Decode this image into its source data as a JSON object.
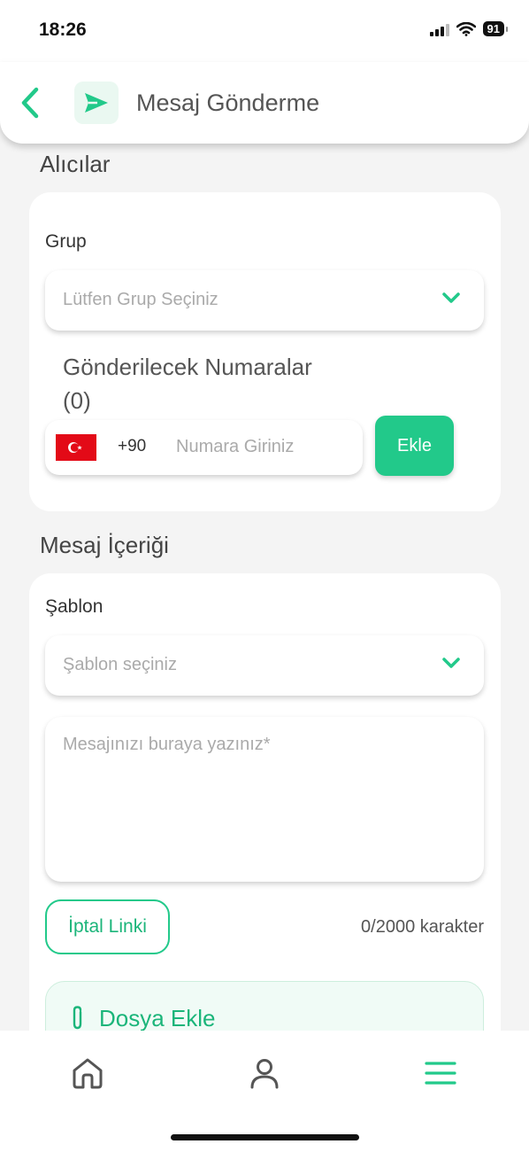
{
  "status_bar": {
    "time": "18:26",
    "battery": "91"
  },
  "header": {
    "title": "Mesaj Gönderme"
  },
  "recipients": {
    "section_title": "Alıcılar",
    "group_label": "Grup",
    "group_placeholder": "Lütfen Grup Seçiniz",
    "numbers_label": "Gönderilecek Numaralar",
    "numbers_count": "(0)",
    "dial_code": "+90",
    "phone_placeholder": "Numara Giriniz",
    "add_button": "Ekle"
  },
  "message": {
    "section_title": "Mesaj İçeriği",
    "template_label": "Şablon",
    "template_placeholder": "Şablon seçiniz",
    "message_placeholder": "Mesajınızı buraya yazınız*",
    "cancel_link_button": "İptal Linki",
    "char_counter": "0/2000 karakter",
    "attach_file": "Dosya Ekle"
  },
  "bottom_nav": {
    "items": [
      "home-icon",
      "profile-icon",
      "menu-icon"
    ]
  },
  "colors": {
    "accent": "#22c98a",
    "accent_dark": "#1bb57a",
    "background": "#f4f4f4",
    "flag_red": "#e30a17"
  }
}
